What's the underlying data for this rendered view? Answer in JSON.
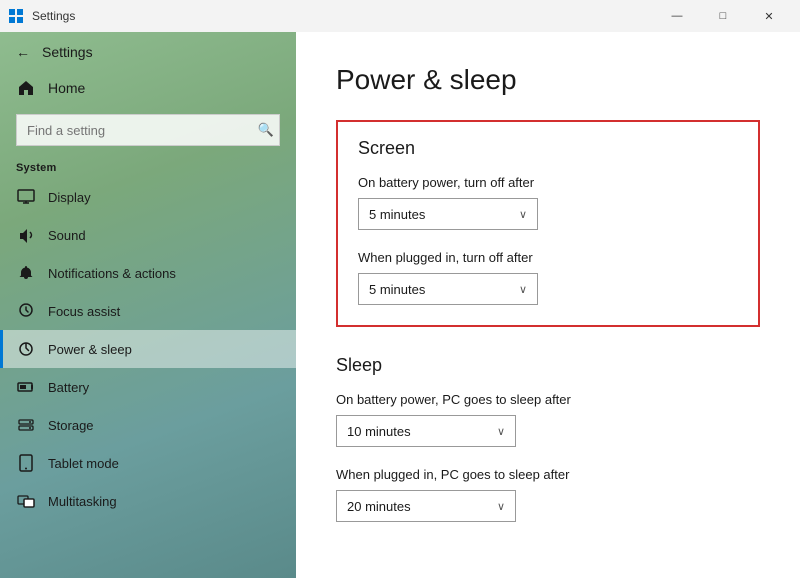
{
  "titlebar": {
    "title": "Settings",
    "minimize_label": "—",
    "maximize_label": "□",
    "close_label": "✕"
  },
  "sidebar": {
    "back_label": "Settings",
    "home_label": "Home",
    "search_placeholder": "Find a setting",
    "section_label": "System",
    "items": [
      {
        "id": "display",
        "label": "Display",
        "icon": "🖥"
      },
      {
        "id": "sound",
        "label": "Sound",
        "icon": "🔊"
      },
      {
        "id": "notifications",
        "label": "Notifications & actions",
        "icon": "🔔"
      },
      {
        "id": "focus-assist",
        "label": "Focus assist",
        "icon": "🌙"
      },
      {
        "id": "power-sleep",
        "label": "Power & sleep",
        "icon": "⏻",
        "active": true
      },
      {
        "id": "battery",
        "label": "Battery",
        "icon": "🔋"
      },
      {
        "id": "storage",
        "label": "Storage",
        "icon": "🗄"
      },
      {
        "id": "tablet-mode",
        "label": "Tablet mode",
        "icon": "📱"
      },
      {
        "id": "multitasking",
        "label": "Multitasking",
        "icon": "⧉"
      }
    ]
  },
  "content": {
    "page_title": "Power & sleep",
    "screen_section": {
      "title": "Screen",
      "battery_label": "On battery power, turn off after",
      "battery_value": "5 minutes",
      "plugged_label": "When plugged in, turn off after",
      "plugged_value": "5 minutes"
    },
    "sleep_section": {
      "title": "Sleep",
      "battery_label": "On battery power, PC goes to sleep after",
      "battery_value": "10 minutes",
      "plugged_label": "When plugged in, PC goes to sleep after",
      "plugged_value": "20 minutes"
    }
  },
  "icons": {
    "chevron_down": "⌄",
    "search": "🔍",
    "back_arrow": "←",
    "home": "⌂",
    "minimize": "─",
    "maximize": "□",
    "close": "✕"
  }
}
